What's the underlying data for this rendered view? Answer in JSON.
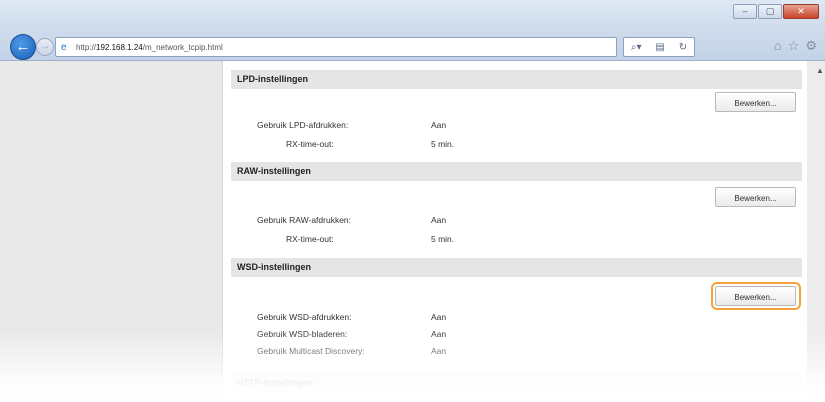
{
  "browser": {
    "url_prefix": "http://",
    "url_host": "192.168.1.24",
    "url_path": "/m_network_tcpip.html",
    "search_icon": "search-icon",
    "window_controls": [
      "–",
      "▢",
      "✕"
    ]
  },
  "sections": [
    {
      "header": "LPD-instellingen",
      "edit_label": "Bewerken...",
      "rows": [
        {
          "label": "Gebruik LPD-afdrukken:",
          "value": "Aan"
        },
        {
          "label": "RX-time-out:",
          "value": "5 min."
        }
      ]
    },
    {
      "header": "RAW-instellingen",
      "edit_label": "Bewerken...",
      "rows": [
        {
          "label": "Gebruik RAW-afdrukken:",
          "value": "Aan"
        },
        {
          "label": "RX-time-out:",
          "value": "5 min."
        }
      ]
    },
    {
      "header": "WSD-instellingen",
      "edit_label": "Bewerken...",
      "rows": [
        {
          "label": "Gebruik WSD-afdrukken:",
          "value": "Aan"
        },
        {
          "label": "Gebruik WSD-bladeren:",
          "value": "Aan"
        },
        {
          "label": "Gebruik Multicast Discovery:",
          "value": "Aan"
        }
      ]
    },
    {
      "header": "HTTP-instellingen"
    }
  ],
  "colors": {
    "highlight": "#f2a33a",
    "section_header_bg": "#e5e5e5"
  }
}
